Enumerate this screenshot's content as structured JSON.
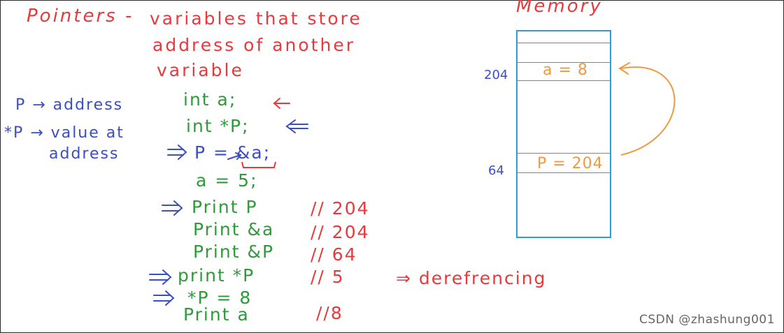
{
  "title": "Pointers -",
  "definition": {
    "line1": "variables that store",
    "line2": "address of another",
    "line3": "variable"
  },
  "notes": {
    "p_address": "P → address",
    "star_p_line1": "*P → value at",
    "star_p_line2": "address"
  },
  "code": [
    {
      "text": "int a;",
      "color": "green"
    },
    {
      "text": "int *P;",
      "color": "green"
    },
    {
      "text": "P = &a;",
      "color": "blue"
    },
    {
      "text": "a = 5;",
      "color": "green"
    },
    {
      "text": "Print P",
      "color": "green"
    },
    {
      "text": "Print &a",
      "color": "green"
    },
    {
      "text": "Print &P",
      "color": "green"
    },
    {
      "text": "print *P",
      "color": "green"
    },
    {
      "text": "*P = 8",
      "color": "green"
    },
    {
      "text": "Print a",
      "color": "green"
    }
  ],
  "comments": [
    "// 204",
    "// 204",
    "// 64",
    "// 5",
    "//8"
  ],
  "dereferencing": "⇒ derefrencing",
  "memory": {
    "title": "Memory",
    "address_a": "204",
    "address_p": "64",
    "cell_a": "a = 8",
    "cell_p": "P = 204"
  },
  "watermark": "CSDN @zhashung001",
  "colors": {
    "red": "#e8393c",
    "blue": "#3a4ec6",
    "green": "#2f9a3a",
    "orange": "#f09a3e",
    "memory_border": "#2d9fd1"
  }
}
